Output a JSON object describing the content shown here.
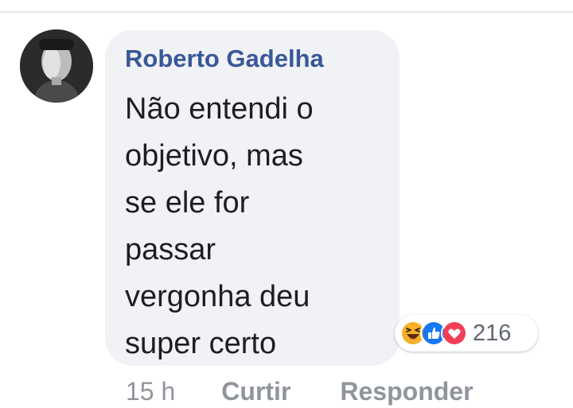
{
  "comment": {
    "author": "Roberto Gadelha",
    "text_lines": [
      "Não entendi o",
      "objetivo, mas",
      "se ele for",
      "passar",
      "vergonha deu",
      "super certo"
    ],
    "reactions": {
      "icons": [
        "haha-icon",
        "like-icon",
        "love-icon"
      ],
      "count": "216"
    },
    "meta": {
      "time": "15 h",
      "like_label": "Curtir",
      "reply_label": "Responder"
    }
  },
  "colors": {
    "author": "#385898",
    "bubble": "#f1f2f6",
    "text": "#1c1e21",
    "meta": "#90949c",
    "like_blue": "#1877f2",
    "love_red": "#f33e58",
    "haha_yellow": "#f7b125"
  }
}
